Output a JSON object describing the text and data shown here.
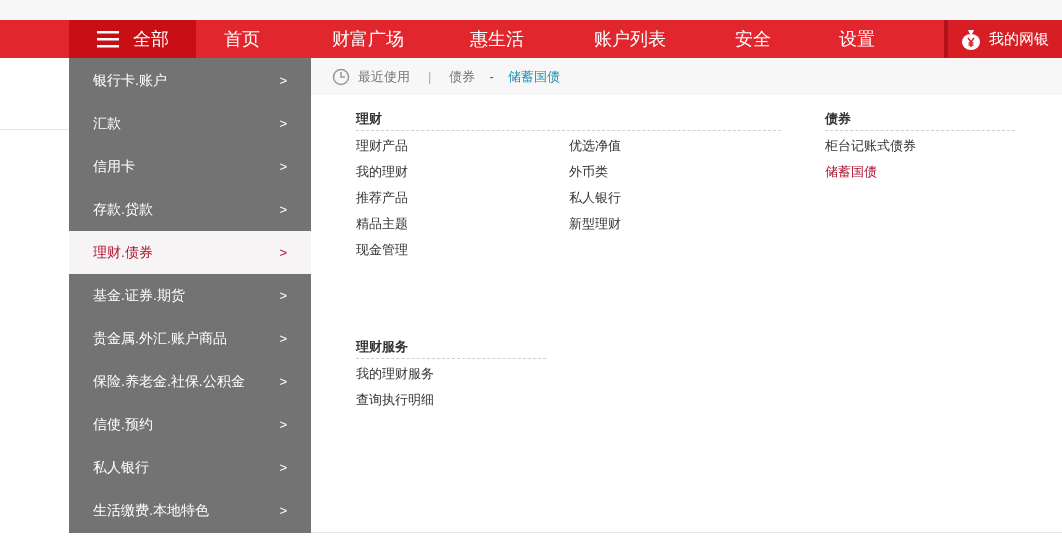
{
  "nav": {
    "all_label": "全部",
    "items": [
      {
        "label": "首页"
      },
      {
        "label": "财富广场"
      },
      {
        "label": "惠生活"
      },
      {
        "label": "账户列表"
      },
      {
        "label": "安全"
      },
      {
        "label": "设置"
      }
    ],
    "my_bank": "我的网银"
  },
  "menu": {
    "items": [
      {
        "label": "银行卡.账户",
        "arrow": ">",
        "selected": false
      },
      {
        "label": "汇款",
        "arrow": ">",
        "selected": false
      },
      {
        "label": "信用卡",
        "arrow": ">",
        "selected": false
      },
      {
        "label": "存款.贷款",
        "arrow": ">",
        "selected": false
      },
      {
        "label": "理财.债券",
        "arrow": ">",
        "selected": true
      },
      {
        "label": "基金.证券.期货",
        "arrow": ">",
        "selected": false
      },
      {
        "label": "贵金属.外汇.账户商品",
        "arrow": ">",
        "selected": false
      },
      {
        "label": "保险.养老金.社保.公积金",
        "arrow": ">",
        "selected": false
      },
      {
        "label": "信使.预约",
        "arrow": ">",
        "selected": false
      },
      {
        "label": "私人银行",
        "arrow": ">",
        "selected": false
      },
      {
        "label": "生活缴费.本地特色",
        "arrow": ">",
        "selected": false
      }
    ]
  },
  "recent": {
    "label": "最近使用",
    "separator": "|",
    "path": [
      {
        "label": "债券",
        "kind": "crumb"
      },
      {
        "label": "-",
        "kind": "dash"
      },
      {
        "label": "储蓄国债",
        "kind": "current"
      }
    ]
  },
  "rows": [
    [
      {
        "title": "理财",
        "columns": [
          [
            {
              "label": "理财产品",
              "selected": false
            },
            {
              "label": "我的理财",
              "selected": false
            },
            {
              "label": "推荐产品",
              "selected": false
            },
            {
              "label": "精品主题",
              "selected": false
            },
            {
              "label": "现金管理",
              "selected": false
            }
          ],
          [
            {
              "label": "优选净值",
              "selected": false
            },
            {
              "label": "外币类",
              "selected": false
            },
            {
              "label": "私人银行",
              "selected": false
            },
            {
              "label": "新型理财",
              "selected": false
            }
          ]
        ]
      },
      {
        "title": "债券",
        "columns": [
          [
            {
              "label": "柜台记账式债券",
              "selected": false
            },
            {
              "label": "储蓄国债",
              "selected": true
            }
          ]
        ]
      }
    ],
    [
      {
        "title": "理财服务",
        "columns": [
          [
            {
              "label": "我的理财服务",
              "selected": false
            },
            {
              "label": "查询执行明细",
              "selected": false
            }
          ]
        ]
      }
    ]
  ]
}
